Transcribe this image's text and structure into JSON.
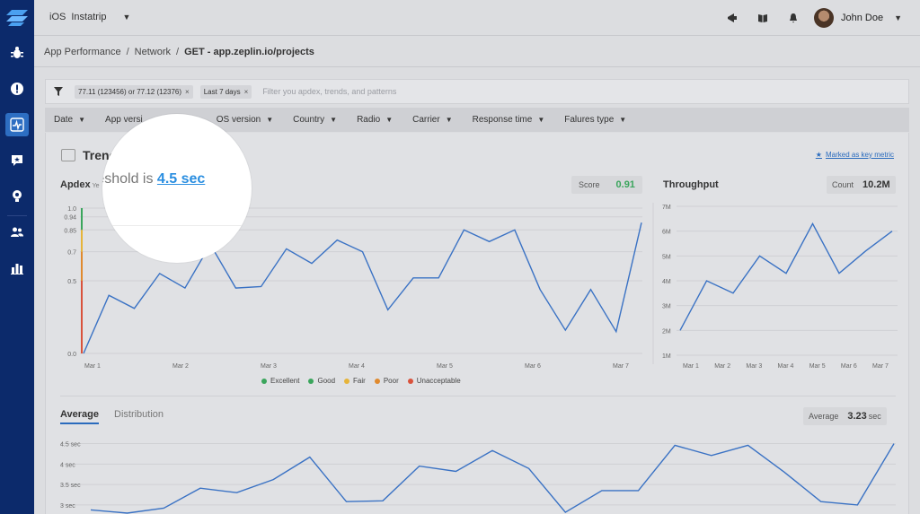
{
  "app": {
    "platform": "iOS",
    "name": "Instatrip"
  },
  "user": {
    "name": "John Doe"
  },
  "breadcrumb": [
    "App Performance",
    "Network",
    "GET - app.zeplin.io/projects"
  ],
  "filter": {
    "chips": [
      "77.11 (123456) or 77.12 (12376)",
      "Last 7 days"
    ],
    "placeholder": "Filter you apdex, trends, and patterns"
  },
  "dropdowns": [
    "Date",
    "App versi",
    "OS version",
    "Country",
    "Radio",
    "Carrier",
    "Response time",
    "Falures type"
  ],
  "trends": {
    "title": "Trend",
    "key_metric": "Marked as key metric",
    "apdex_title": "Apdex",
    "apdex_sub": "Ye",
    "score_label": "Score",
    "score_value": "0.91",
    "throughput_title": "Throughput",
    "count_label": "Count",
    "count_value": "10.2M",
    "legend": [
      {
        "label": "Excellent",
        "color": "#3aa55c"
      },
      {
        "label": "Good",
        "color": "#3aa55c"
      },
      {
        "label": "Fair",
        "color": "#e6b43a"
      },
      {
        "label": "Poor",
        "color": "#e08a2e"
      },
      {
        "label": "Unacceptable",
        "color": "#d9523c"
      }
    ]
  },
  "tabs": {
    "average": "Average",
    "distribution": "Distribution"
  },
  "average": {
    "label": "Average",
    "value": "3.23",
    "unit": "sec"
  },
  "magnifier": {
    "text_prefix": "reshold is ",
    "value": "4.5 sec"
  },
  "colors": {
    "line": "#3a72c4",
    "accent": "#2a6bbd",
    "sidebar": "#0c2a6b"
  },
  "chart_data": [
    {
      "type": "line",
      "ylabel_ticks": [
        "1.0",
        "0.94",
        "0.85",
        "0.7",
        "0.5",
        "0.0"
      ],
      "ytick_values": [
        1.0,
        0.94,
        0.85,
        0.7,
        0.5,
        0.0
      ],
      "xtick_labels": [
        "Mar 1",
        "Mar 2",
        "Mar 3",
        "Mar 4",
        "Mar 5",
        "Mar 6",
        "Mar 7"
      ],
      "ylim": [
        0,
        1
      ],
      "values": [
        0.0,
        0.4,
        0.31,
        0.55,
        0.45,
        0.75,
        0.45,
        0.46,
        0.72,
        0.62,
        0.78,
        0.7,
        0.3,
        0.52,
        0.52,
        0.85,
        0.77,
        0.85,
        0.44,
        0.16,
        0.44,
        0.15,
        0.9
      ]
    },
    {
      "type": "line",
      "ylabel_ticks": [
        "7M",
        "6M",
        "5M",
        "4M",
        "3M",
        "2M",
        "1M"
      ],
      "ytick_values": [
        7,
        6,
        5,
        4,
        3,
        2,
        1
      ],
      "xtick_labels": [
        "Mar 1",
        "Mar 2",
        "Mar 3",
        "Mar 4",
        "Mar 5",
        "Mar 6",
        "Mar 7"
      ],
      "ylim": [
        1,
        7
      ],
      "values": [
        2.0,
        4.0,
        3.5,
        5.0,
        4.3,
        6.3,
        4.3,
        5.2,
        6.0
      ]
    },
    {
      "type": "line",
      "ylabel_ticks": [
        "4.5 sec",
        "4 sec",
        "3.5 sec",
        "3 sec"
      ],
      "ytick_values": [
        4.5,
        4,
        3.5,
        3
      ],
      "ylim": [
        2.8,
        4.6
      ],
      "values": [
        2.88,
        2.8,
        2.92,
        3.41,
        3.3,
        3.62,
        4.17,
        3.08,
        3.1,
        3.95,
        3.82,
        4.33,
        3.89,
        2.82,
        3.35,
        3.35,
        4.46,
        4.21,
        4.46,
        3.8,
        3.08,
        3.0,
        4.5
      ]
    }
  ]
}
